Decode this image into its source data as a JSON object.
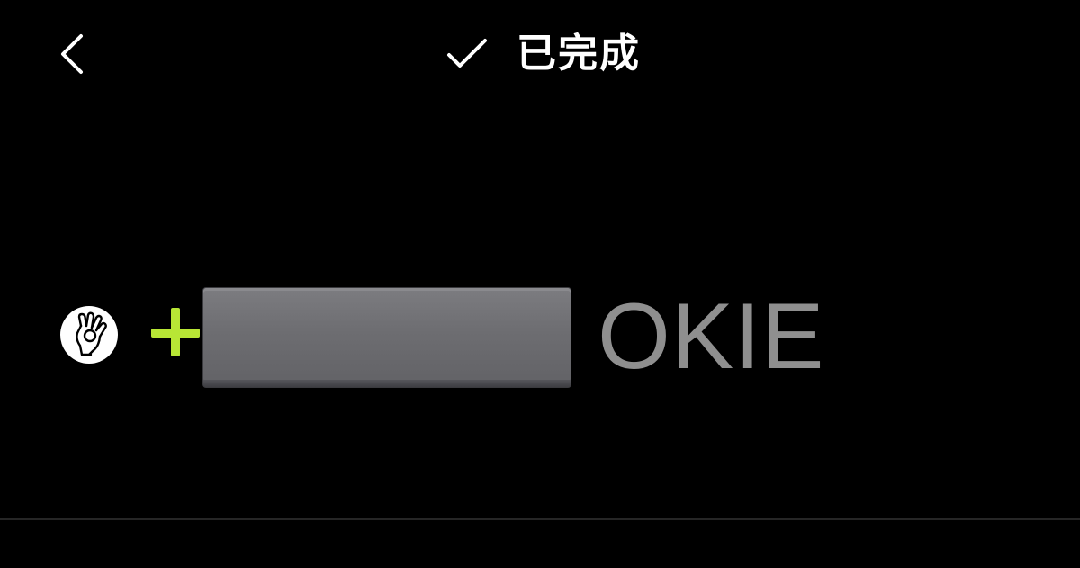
{
  "header": {
    "back_icon": "chevron-left-icon",
    "status_icon": "check-icon",
    "status_label": "已完成"
  },
  "message": {
    "emoji_icon": "ok-hand-icon",
    "plus_icon": "plus-icon",
    "keycap_icon": "blank-keycap-icon",
    "suffix_text": "OKIE"
  },
  "colors": {
    "background": "#000000",
    "plus": "#b8e635",
    "suffix_text": "#8f8f8f",
    "keycap": "#6d6d71"
  }
}
